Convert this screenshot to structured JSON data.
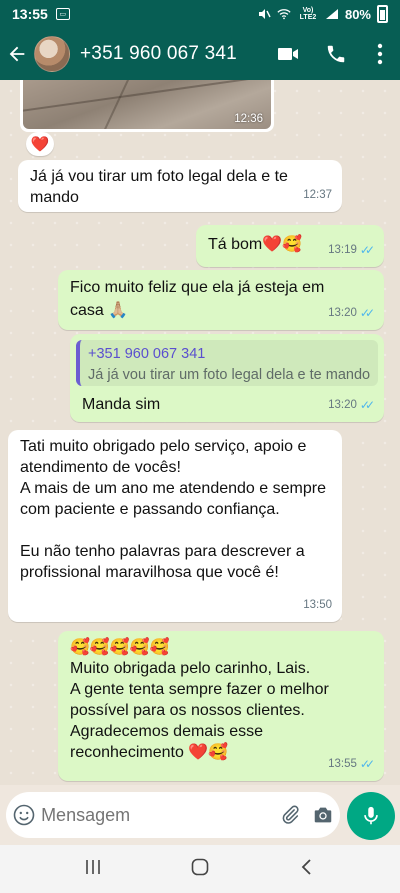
{
  "status_bar": {
    "time": "13:55",
    "network": "Vo) LTE2",
    "battery": "80%"
  },
  "header": {
    "contact": "+351 960 067 341"
  },
  "photo": {
    "time": "12:36",
    "reaction": "❤️"
  },
  "messages": [
    {
      "text": "Já já vou tirar um foto legal dela e te mando",
      "time": "12:37"
    },
    {
      "text": "Tá bom❤️🥰",
      "time": "13:19"
    },
    {
      "text": "Fico muito feliz que ela já esteja em casa 🙏🏼",
      "time": "13:20"
    },
    {
      "quote_name": "+351 960 067 341",
      "quote_text": "Já já vou tirar um foto legal dela e te mando",
      "text": "Manda sim",
      "time": "13:20"
    },
    {
      "text": "Tati muito obrigado pelo serviço, apoio e atendimento de vocês!\nA mais de um ano me atendendo e sempre com paciente e passando confiança.\n\nEu não tenho palavras para descrever a profissional maravilhosa que você é!",
      "time": "13:50"
    },
    {
      "text": "🥰🥰🥰🥰🥰\nMuito obrigada pelo carinho, Lais.\nA gente tenta sempre fazer o melhor possível para os nossos clientes. Agradecemos demais esse reconhecimento ❤️🥰",
      "time": "13:55"
    }
  ],
  "input": {
    "placeholder": "Mensagem"
  },
  "colors": {
    "header": "#075e54",
    "outgoing": "#dcf8c6",
    "incoming": "#ffffff",
    "read_ticks": "#4fb6ec",
    "mic": "#00a884"
  }
}
